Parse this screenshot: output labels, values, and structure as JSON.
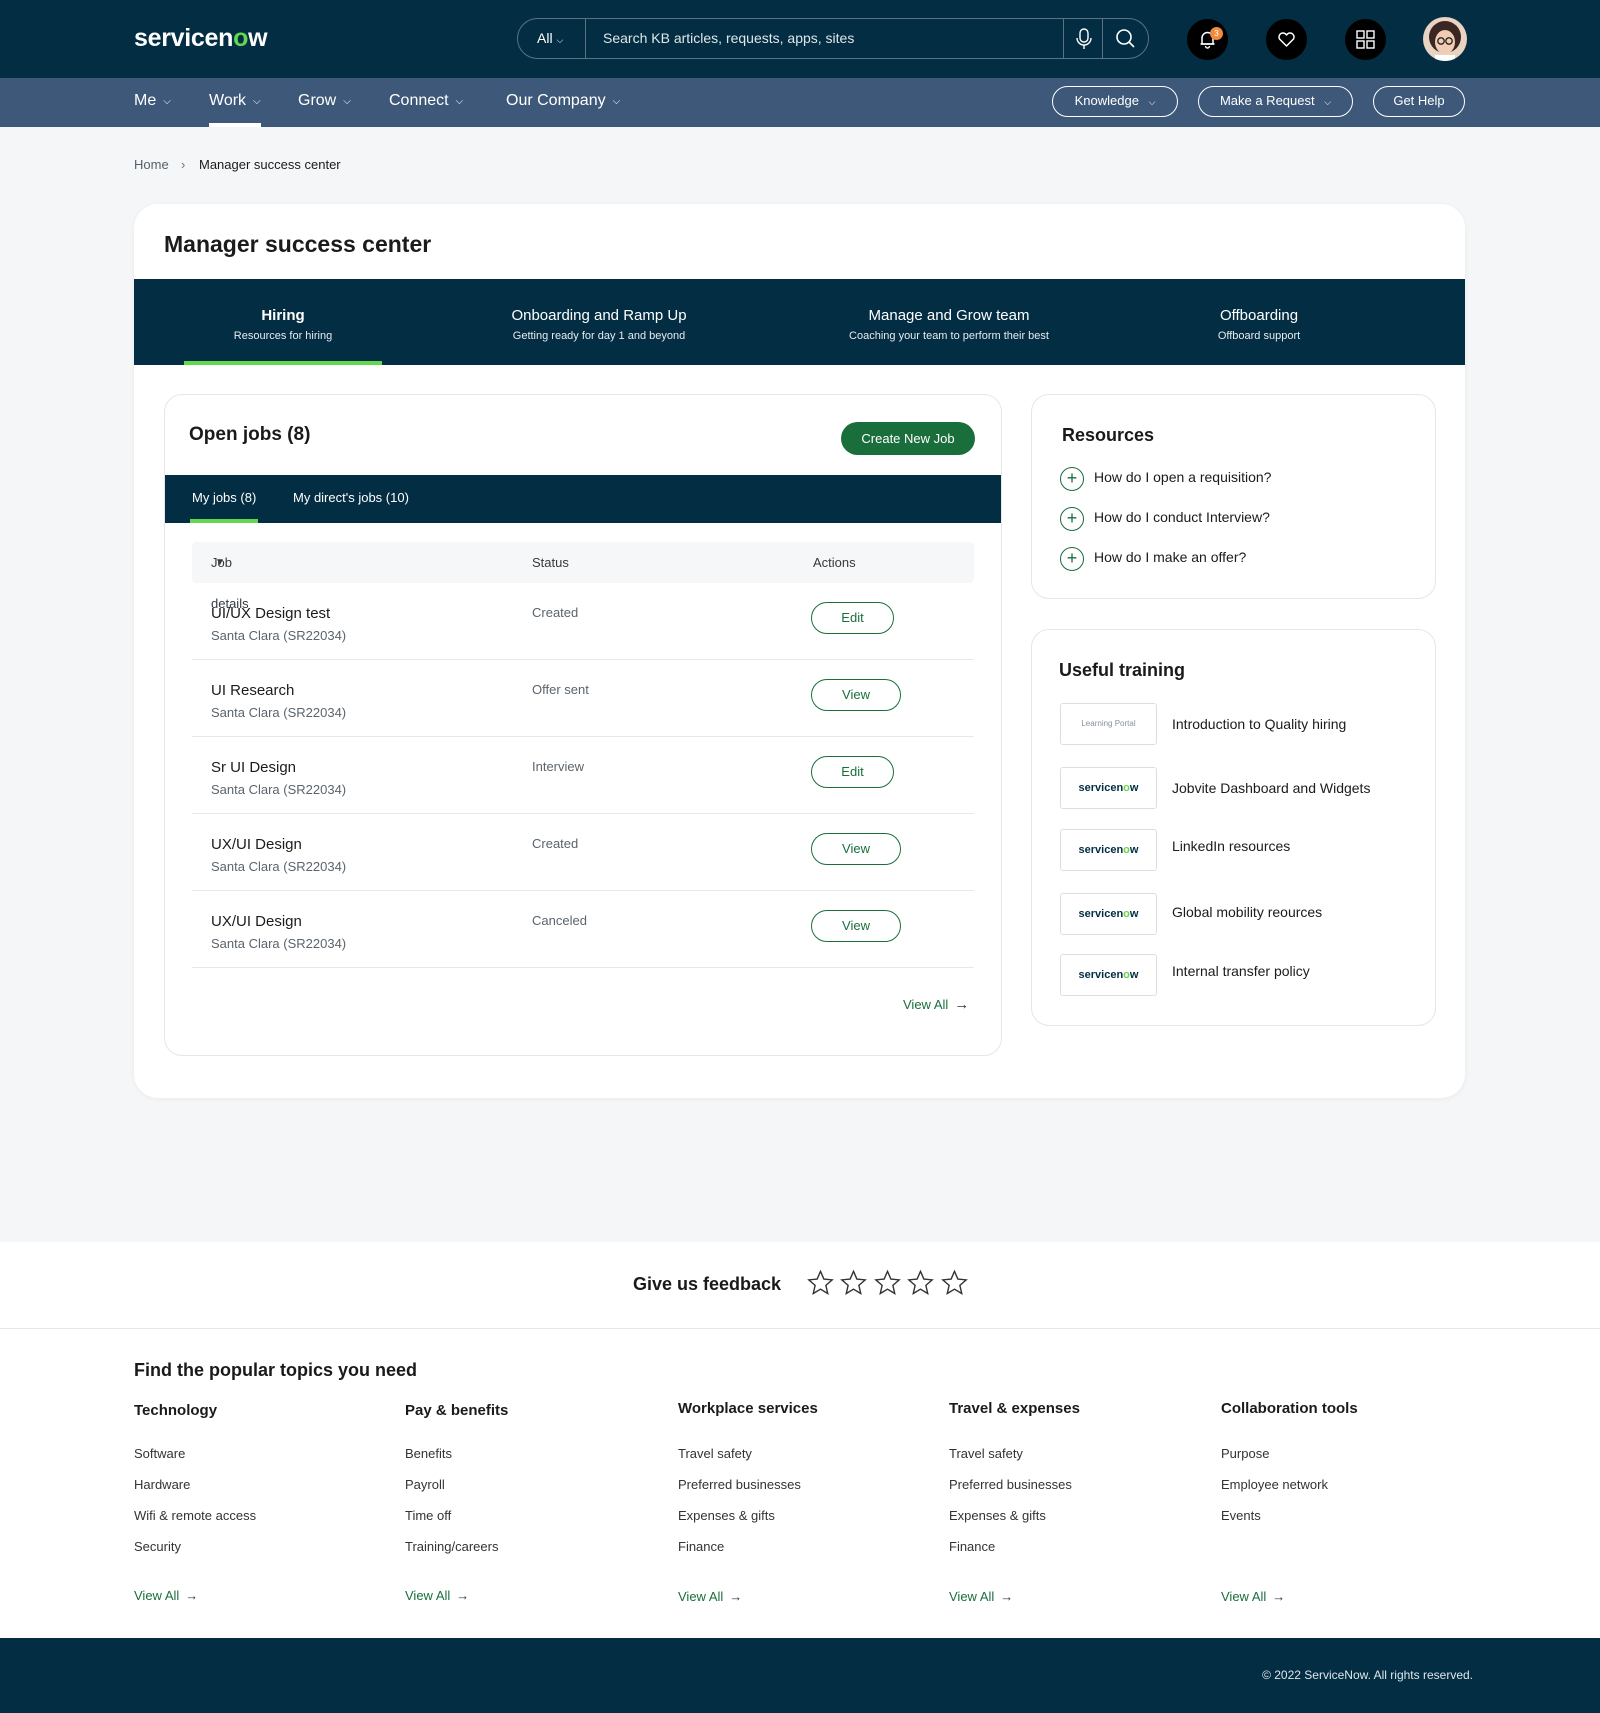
{
  "header": {
    "logo_text": "servicen",
    "logo_o": "o",
    "logo_end": "w",
    "search_scope": "All",
    "search_placeholder": "Search KB articles, requests, apps, sites",
    "notification_count": "3",
    "icons": [
      "microphone-icon",
      "search-icon",
      "bell-icon",
      "heart-icon",
      "grid-icon"
    ]
  },
  "nav": {
    "items": [
      "Me",
      "Work",
      "Grow",
      "Connect",
      "Our Company"
    ],
    "active": "Work",
    "buttons": {
      "knowledge": "Knowledge",
      "request": "Make a Request",
      "help": "Get Help"
    }
  },
  "breadcrumb": {
    "home": "Home",
    "current": "Manager success center"
  },
  "page": {
    "title": "Manager success center",
    "tabs": [
      {
        "title": "Hiring",
        "subtitle": "Resources for hiring"
      },
      {
        "title": "Onboarding and Ramp Up",
        "subtitle": "Getting ready for day 1 and beyond"
      },
      {
        "title": "Manage and Grow team",
        "subtitle": "Coaching your team to perform their best"
      },
      {
        "title": "Offboarding",
        "subtitle": "Offboard support"
      }
    ]
  },
  "jobs": {
    "title": "Open jobs (8)",
    "create_button": "Create New Job",
    "subtabs": [
      "My jobs (8)",
      "My direct's jobs (10)"
    ],
    "columns": [
      "Job details",
      "Status",
      "Actions"
    ],
    "rows": [
      {
        "title": "UI/UX Design test",
        "location": "Santa Clara (SR22034)",
        "status": "Created",
        "action": "Edit"
      },
      {
        "title": "UI Research",
        "location": "Santa Clara (SR22034)",
        "status": "Offer sent",
        "action": "View"
      },
      {
        "title": "Sr UI Design",
        "location": "Santa Clara (SR22034)",
        "status": "Interview",
        "action": "Edit"
      },
      {
        "title": "UX/UI Design",
        "location": "Santa Clara (SR22034)",
        "status": "Created",
        "action": "View"
      },
      {
        "title": "UX/UI Design",
        "location": "Santa Clara (SR22034)",
        "status": "Canceled",
        "action": "View"
      }
    ],
    "view_all": "View All"
  },
  "resources": {
    "title": "Resources",
    "items": [
      "How do I open a requisition?",
      "How do I conduct Interview?",
      "How do I make an offer?"
    ]
  },
  "training": {
    "title": "Useful training",
    "learning_portal_label": "Learning Portal",
    "items": [
      "Introduction to Quality hiring",
      "Jobvite Dashboard and Widgets",
      "LinkedIn resources",
      "Global mobility reources",
      "Internal transfer policy"
    ]
  },
  "feedback": {
    "label": "Give us feedback",
    "stars": 5
  },
  "topics": {
    "title": "Find the popular topics you need",
    "columns": [
      {
        "title": "Technology",
        "links": [
          "Software",
          "Hardware",
          "Wifi & remote access",
          "Security"
        ]
      },
      {
        "title": "Pay & benefits",
        "links": [
          "Benefits",
          "Payroll",
          "Time off",
          "Training/careers"
        ]
      },
      {
        "title": "Workplace services",
        "links": [
          "Travel safety",
          "Preferred businesses",
          "Expenses & gifts",
          "Finance"
        ]
      },
      {
        "title": "Travel & expenses",
        "links": [
          "Travel safety",
          "Preferred businesses",
          "Expenses & gifts",
          "Finance"
        ]
      },
      {
        "title": "Collaboration tools",
        "links": [
          "Purpose",
          "Employee network",
          "Events"
        ]
      }
    ],
    "view_all": "View All"
  },
  "footer": {
    "copyright": "© 2022 ServiceNow. All rights reserved."
  },
  "colors": {
    "navy": "#032d42",
    "nav_blue": "#3d5878",
    "green": "#1a6e3c",
    "accent_green": "#62d84e"
  }
}
